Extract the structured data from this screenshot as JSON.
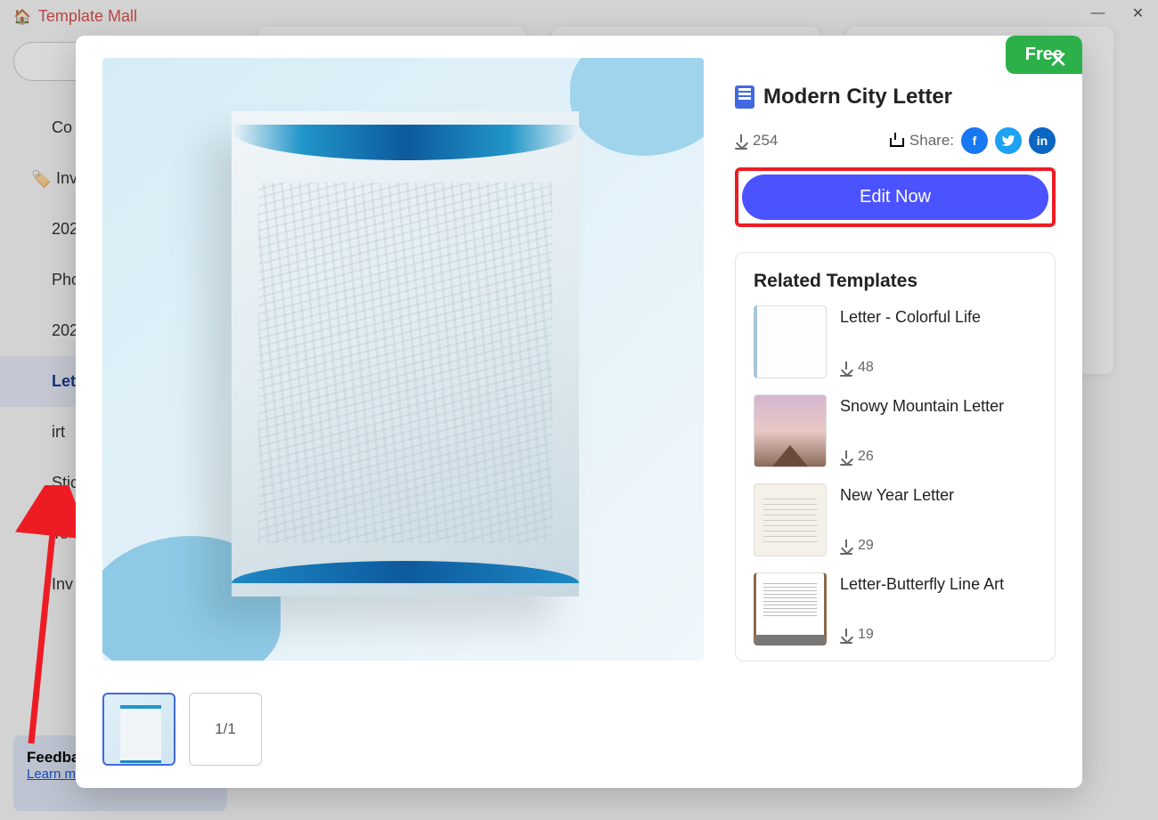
{
  "header": {
    "title": "Template Mall"
  },
  "sidebar": {
    "items": [
      {
        "label": "Co"
      },
      {
        "label": "Inv",
        "hasIcon": true
      },
      {
        "label": "202"
      },
      {
        "label": "Pho"
      },
      {
        "label": "202"
      },
      {
        "label": "Let",
        "selected": true
      },
      {
        "label": "irt"
      },
      {
        "label": "Stic"
      },
      {
        "label": "To-"
      },
      {
        "label": "Inv"
      }
    ]
  },
  "feedback": {
    "title": "Feedba",
    "link": "Learn m"
  },
  "modal": {
    "badge": "Free",
    "template_title": "Modern City Letter",
    "download_count": "254",
    "share_label": "Share:",
    "edit_button": "Edit Now",
    "page_indicator": "1/1",
    "related_title": "Related Templates",
    "related": [
      {
        "name": "Letter - Colorful Life",
        "downloads": "48"
      },
      {
        "name": "Snowy Mountain Letter",
        "downloads": "26"
      },
      {
        "name": "New Year Letter",
        "downloads": "29"
      },
      {
        "name": "Letter-Butterfly Line Art",
        "downloads": "19"
      }
    ]
  }
}
